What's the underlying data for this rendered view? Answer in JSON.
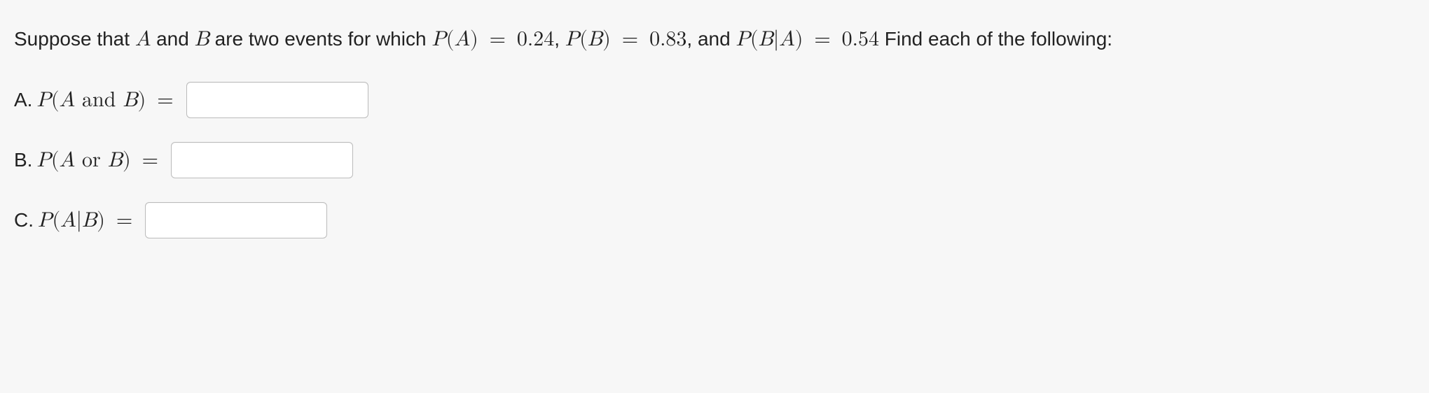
{
  "intro": {
    "t1": "Suppose that ",
    "A": "A",
    "t2": " and ",
    "B": "B",
    "t3": " are two events for which ",
    "pA": "P",
    "lpA": "(",
    "vA": "A",
    "rpA": ")",
    "eqA": " = ",
    "valA": "0.24",
    "comma1": ", ",
    "pB": "P",
    "lpB": "(",
    "vB": "B",
    "rpB": ")",
    "eqB": " = ",
    "valB": "0.83",
    "comma2": ", and ",
    "pBA": "P",
    "lpBA": "(",
    "vBA1": "B",
    "barBA": "|",
    "vBA2": "A",
    "rpBA": ")",
    "eqBA": " = ",
    "valBA": "0.54",
    "t4": " Find each of the following:"
  },
  "parts": {
    "a": {
      "letter": "A. ",
      "P": "P",
      "lp": "(",
      "v1": "A",
      "op": " and ",
      "v2": "B",
      "rp": ")",
      "eq": " = ",
      "value": ""
    },
    "b": {
      "letter": "B. ",
      "P": "P",
      "lp": "(",
      "v1": "A",
      "op": " or ",
      "v2": "B",
      "rp": ")",
      "eq": " = ",
      "value": ""
    },
    "c": {
      "letter": "C. ",
      "P": "P",
      "lp": "(",
      "v1": "A",
      "bar": "|",
      "v2": "B",
      "rp": ")",
      "eq": " = ",
      "value": ""
    }
  }
}
